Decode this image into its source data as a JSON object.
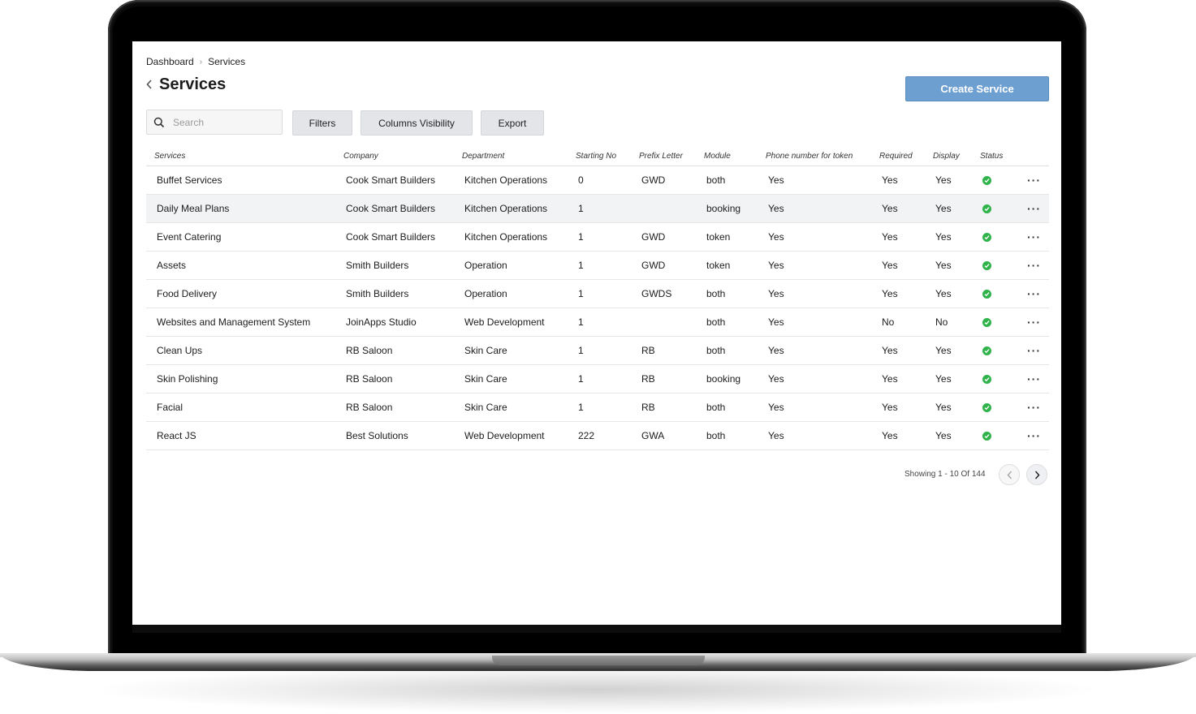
{
  "breadcrumb": {
    "items": [
      "Dashboard",
      "Services"
    ],
    "separator": "›"
  },
  "page": {
    "title": "Services",
    "back_icon": "chevron-left-icon"
  },
  "toolbar": {
    "create_label": "Create Service",
    "search_placeholder": "Search",
    "search_value": "",
    "filters_label": "Filters",
    "columns_label": "Columns Visibility",
    "export_label": "Export"
  },
  "table": {
    "headers": [
      "Services",
      "Company",
      "Department",
      "Starting No",
      "Prefix Letter",
      "Module",
      "Phone number for token",
      "Required",
      "Display",
      "Status"
    ],
    "rows": [
      {
        "service": "Buffet Services",
        "company": "Cook Smart Builders",
        "department": "Kitchen Operations",
        "starting_no": "0",
        "prefix": "GWD",
        "module": "both",
        "phone": "Yes",
        "required": "Yes",
        "display": "Yes",
        "status": "active"
      },
      {
        "service": "Daily Meal Plans",
        "company": "Cook Smart Builders",
        "department": "Kitchen Operations",
        "starting_no": "1",
        "prefix": "",
        "module": "booking",
        "phone": "Yes",
        "required": "Yes",
        "display": "Yes",
        "status": "active"
      },
      {
        "service": "Event Catering",
        "company": "Cook Smart Builders",
        "department": "Kitchen Operations",
        "starting_no": "1",
        "prefix": "GWD",
        "module": "token",
        "phone": "Yes",
        "required": "Yes",
        "display": "Yes",
        "status": "active"
      },
      {
        "service": "Assets",
        "company": "Smith Builders",
        "department": "Operation",
        "starting_no": "1",
        "prefix": "GWD",
        "module": "token",
        "phone": "Yes",
        "required": "Yes",
        "display": "Yes",
        "status": "active"
      },
      {
        "service": "Food Delivery",
        "company": "Smith Builders",
        "department": "Operation",
        "starting_no": "1",
        "prefix": "GWDS",
        "module": "both",
        "phone": "Yes",
        "required": "Yes",
        "display": "Yes",
        "status": "active"
      },
      {
        "service": "Websites and Management System",
        "company": "JoinApps Studio",
        "department": "Web Development",
        "starting_no": "1",
        "prefix": "",
        "module": "both",
        "phone": "Yes",
        "required": "No",
        "display": "No",
        "status": "active"
      },
      {
        "service": "Clean Ups",
        "company": "RB Saloon",
        "department": "Skin Care",
        "starting_no": "1",
        "prefix": "RB",
        "module": "both",
        "phone": "Yes",
        "required": "Yes",
        "display": "Yes",
        "status": "active"
      },
      {
        "service": "Skin Polishing",
        "company": "RB Saloon",
        "department": "Skin Care",
        "starting_no": "1",
        "prefix": "RB",
        "module": "booking",
        "phone": "Yes",
        "required": "Yes",
        "display": "Yes",
        "status": "active"
      },
      {
        "service": "Facial",
        "company": "RB Saloon",
        "department": "Skin Care",
        "starting_no": "1",
        "prefix": "RB",
        "module": "both",
        "phone": "Yes",
        "required": "Yes",
        "display": "Yes",
        "status": "active"
      },
      {
        "service": "React JS",
        "company": "Best Solutions",
        "department": "Web Development",
        "starting_no": "222",
        "prefix": "GWA",
        "module": "both",
        "phone": "Yes",
        "required": "Yes",
        "display": "Yes",
        "status": "active"
      }
    ],
    "row_action_icon": "more-horizontal-icon",
    "status_icon": "check-circle-icon"
  },
  "pagination": {
    "summary": "Showing 1 - 10 Of 144",
    "prev_icon": "chevron-left-icon",
    "next_icon": "chevron-right-icon"
  },
  "colors": {
    "accent": "#6e9fd1",
    "status_active": "#2fb34a",
    "row_highlight": "#f2f3f5",
    "button_gray": "#e3e5e8"
  }
}
